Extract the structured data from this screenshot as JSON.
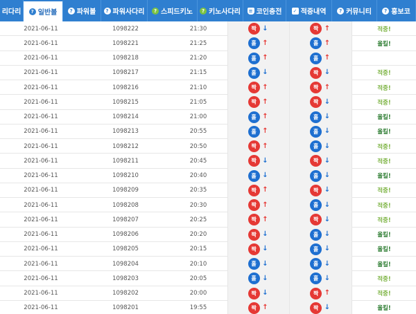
{
  "nav": {
    "items": [
      {
        "label": "리다리",
        "icon": "",
        "active": false,
        "width": 34
      },
      {
        "label": "일반볼",
        "icon": "help-icon",
        "glyph": "?",
        "active": true,
        "width": 57
      },
      {
        "label": "파워볼",
        "icon": "help-icon",
        "glyph": "?",
        "active": false,
        "width": 55
      },
      {
        "label": "파워사다리",
        "icon": "help-icon",
        "glyph": "?",
        "active": false,
        "width": 67
      },
      {
        "label": "스피드키노",
        "icon": "help-icon",
        "glyph": "?",
        "active": false,
        "width": 72
      },
      {
        "label": "키노사다리",
        "icon": "help-icon",
        "glyph": "?",
        "active": false,
        "width": 66
      },
      {
        "label": "코인충전",
        "icon": "database-icon",
        "glyph": "≡",
        "active": false,
        "width": 62
      },
      {
        "label": "적중내역",
        "icon": "checkbox-icon",
        "glyph": "✓",
        "active": false,
        "width": 66
      },
      {
        "label": "커뮤니티",
        "icon": "help-icon",
        "glyph": "?",
        "active": false,
        "width": 65
      },
      {
        "label": "홍보코",
        "icon": "help-icon",
        "glyph": "?",
        "active": false,
        "width": 56
      }
    ]
  },
  "ball_text": {
    "odd": "짝",
    "even": "홀"
  },
  "rows": [
    {
      "date": "2021-06-11",
      "num": "1098222",
      "time": "21:30",
      "a": "odd",
      "a_dir": "down",
      "b": "odd",
      "b_dir": "up",
      "result": "적중!",
      "res_type": "green"
    },
    {
      "date": "2021-06-11",
      "num": "1098221",
      "time": "21:25",
      "a": "even",
      "a_dir": "up",
      "b": "even",
      "b_dir": "up",
      "result": "올킬!",
      "res_type": "blue"
    },
    {
      "date": "2021-06-11",
      "num": "1098218",
      "time": "21:20",
      "a": "even",
      "a_dir": "up",
      "b": "even",
      "b_dir": "up",
      "result": "",
      "res_type": "green"
    },
    {
      "date": "2021-06-11",
      "num": "1098217",
      "time": "21:15",
      "a": "even",
      "a_dir": "down",
      "b": "odd",
      "b_dir": "down",
      "result": "적중!",
      "res_type": "green"
    },
    {
      "date": "2021-06-11",
      "num": "1098216",
      "time": "21:10",
      "a": "odd",
      "a_dir": "up",
      "b": "odd",
      "b_dir": "up",
      "result": "적중!",
      "res_type": "green"
    },
    {
      "date": "2021-06-11",
      "num": "1098215",
      "time": "21:05",
      "a": "odd",
      "a_dir": "up",
      "b": "odd",
      "b_dir": "down",
      "result": "적중!",
      "res_type": "green"
    },
    {
      "date": "2021-06-11",
      "num": "1098214",
      "time": "21:00",
      "a": "even",
      "a_dir": "up",
      "b": "even",
      "b_dir": "down",
      "result": "올킬!",
      "res_type": "blue"
    },
    {
      "date": "2021-06-11",
      "num": "1098213",
      "time": "20:55",
      "a": "even",
      "a_dir": "up",
      "b": "even",
      "b_dir": "down",
      "result": "올킬!",
      "res_type": "blue"
    },
    {
      "date": "2021-06-11",
      "num": "1098212",
      "time": "20:50",
      "a": "odd",
      "a_dir": "up",
      "b": "even",
      "b_dir": "down",
      "result": "적중!",
      "res_type": "green"
    },
    {
      "date": "2021-06-11",
      "num": "1098211",
      "time": "20:45",
      "a": "odd",
      "a_dir": "down",
      "b": "odd",
      "b_dir": "down",
      "result": "적중!",
      "res_type": "green"
    },
    {
      "date": "2021-06-11",
      "num": "1098210",
      "time": "20:40",
      "a": "even",
      "a_dir": "down",
      "b": "even",
      "b_dir": "down",
      "result": "올킬!",
      "res_type": "blue"
    },
    {
      "date": "2021-06-11",
      "num": "1098209",
      "time": "20:35",
      "a": "odd",
      "a_dir": "up",
      "b": "odd",
      "b_dir": "down",
      "result": "적중!",
      "res_type": "green"
    },
    {
      "date": "2021-06-11",
      "num": "1098208",
      "time": "20:30",
      "a": "odd",
      "a_dir": "up",
      "b": "even",
      "b_dir": "down",
      "result": "적중!",
      "res_type": "green"
    },
    {
      "date": "2021-06-11",
      "num": "1098207",
      "time": "20:25",
      "a": "odd",
      "a_dir": "up",
      "b": "odd",
      "b_dir": "down",
      "result": "적중!",
      "res_type": "green"
    },
    {
      "date": "2021-06-11",
      "num": "1098206",
      "time": "20:20",
      "a": "odd",
      "a_dir": "down",
      "b": "even",
      "b_dir": "down",
      "result": "올킬!",
      "res_type": "blue"
    },
    {
      "date": "2021-06-11",
      "num": "1098205",
      "time": "20:15",
      "a": "odd",
      "a_dir": "down",
      "b": "even",
      "b_dir": "down",
      "result": "올킬!",
      "res_type": "blue"
    },
    {
      "date": "2021-06-11",
      "num": "1098204",
      "time": "20:10",
      "a": "even",
      "a_dir": "down",
      "b": "even",
      "b_dir": "down",
      "result": "올킬!",
      "res_type": "blue"
    },
    {
      "date": "2021-06-11",
      "num": "1098203",
      "time": "20:05",
      "a": "even",
      "a_dir": "down",
      "b": "even",
      "b_dir": "down",
      "result": "적중!",
      "res_type": "green"
    },
    {
      "date": "2021-06-11",
      "num": "1098202",
      "time": "20:00",
      "a": "odd",
      "a_dir": "down",
      "b": "odd",
      "b_dir": "up",
      "result": "적중!",
      "res_type": "green"
    },
    {
      "date": "2021-06-11",
      "num": "1098201",
      "time": "19:55",
      "a": "odd",
      "a_dir": "up",
      "b": "odd",
      "b_dir": "down",
      "result": "올킬!",
      "res_type": "blue"
    }
  ]
}
